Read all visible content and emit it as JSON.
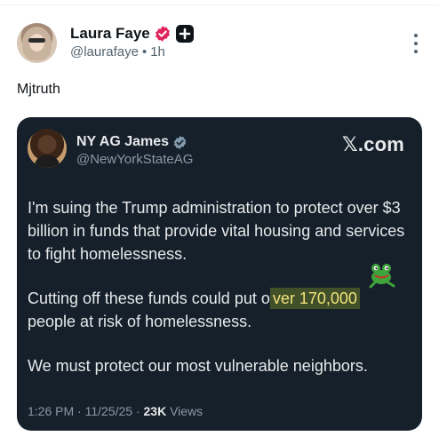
{
  "post": {
    "display_name": "Laura Faye",
    "handle": "@laurafaye",
    "separator": "•",
    "time": "1h",
    "text": "Mjtruth",
    "badge_color": "#e0245e"
  },
  "quote": {
    "display_name": "NY AG James",
    "handle": "@NewYorkStateAG",
    "source_x": "𝕏",
    "source_domain": ".com",
    "paragraph_1": "I'm suing the Trump administration to protect over $3 billion in funds that provide vital housing and services to fight homelessness.",
    "paragraph_2_before": "Cutting off these funds could put o",
    "paragraph_2_highlight": "ver 170,000",
    "paragraph_2_after": "people at risk of homelessness.",
    "paragraph_3": "We must protect our most vulnerable neighbors.",
    "time": "1:26 PM",
    "sep1": "·",
    "date": "11/25/25",
    "sep2": "·",
    "views_count": "23K",
    "views_label": "Views",
    "card_bg": "#15202b",
    "highlight_color": "#f2e27a"
  }
}
